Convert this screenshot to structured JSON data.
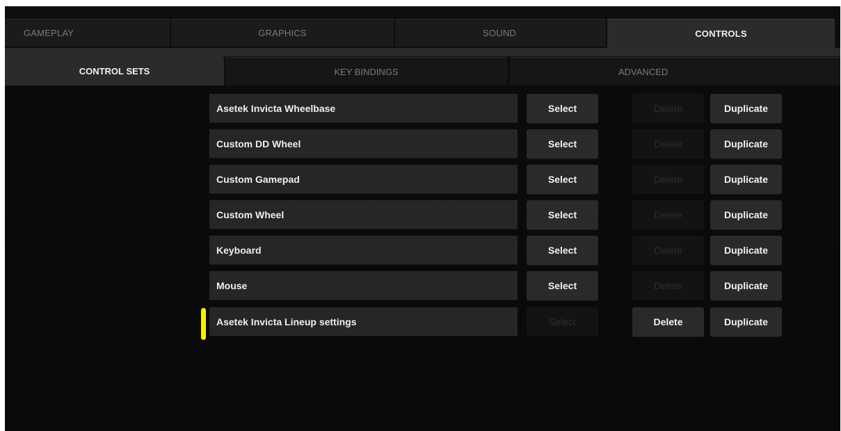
{
  "top_tabs": {
    "gameplay": "GAMEPLAY",
    "graphics": "GRAPHICS",
    "sound": "SOUND",
    "controls": "CONTROLS"
  },
  "sub_tabs": {
    "control_sets": "CONTROL SETS",
    "key_bindings": "KEY BINDINGS",
    "advanced": "ADVANCED"
  },
  "buttons": {
    "select": "Select",
    "delete": "Delete",
    "duplicate": "Duplicate"
  },
  "control_sets": [
    {
      "name": "Asetek Invicta Wheelbase",
      "select_enabled": true,
      "delete_enabled": false,
      "active": false
    },
    {
      "name": "Custom DD Wheel",
      "select_enabled": true,
      "delete_enabled": false,
      "active": false
    },
    {
      "name": "Custom Gamepad",
      "select_enabled": true,
      "delete_enabled": false,
      "active": false
    },
    {
      "name": "Custom Wheel",
      "select_enabled": true,
      "delete_enabled": false,
      "active": false
    },
    {
      "name": "Keyboard",
      "select_enabled": true,
      "delete_enabled": false,
      "active": false
    },
    {
      "name": "Mouse",
      "select_enabled": true,
      "delete_enabled": false,
      "active": false
    },
    {
      "name": "Asetek Invicta Lineup settings",
      "select_enabled": false,
      "delete_enabled": true,
      "active": true
    }
  ],
  "colors": {
    "background": "#0e0e0e",
    "active_tab": "#2b2b2b",
    "row": "#262626",
    "button": "#2a2a2a",
    "active_indicator": "#f6f000"
  }
}
